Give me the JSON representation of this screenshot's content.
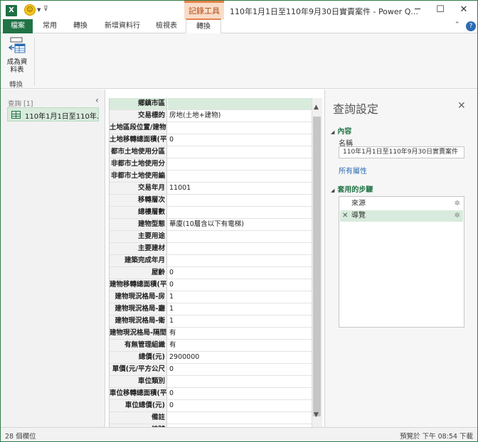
{
  "app": {
    "window_title": "110年1月1日至110年9月30日實賣案件 - Power Q...",
    "contextual_tools": "記錄工具",
    "window_controls": [
      "minimize-icon",
      "maximize-icon",
      "close-icon"
    ]
  },
  "ribbon": {
    "tabs": [
      {
        "label": "檔案",
        "kind": "file"
      },
      {
        "label": "常用"
      },
      {
        "label": "轉換"
      },
      {
        "label": "新增資料行"
      },
      {
        "label": "檢視表"
      },
      {
        "label": "轉換",
        "active": true
      }
    ],
    "convert_button_label": "成為資\n料表",
    "group_label": "轉換"
  },
  "queries": {
    "header": "查詢 [1]",
    "items": [
      {
        "label": "110年1月1日至110年..."
      }
    ]
  },
  "grid": {
    "rows": [
      {
        "field": "鄉鎮市區",
        "value": ""
      },
      {
        "field": "交易標的",
        "value": "房地(土地+建物)"
      },
      {
        "field": "土地區段位置/建物",
        "value": ""
      },
      {
        "field": "土地移轉總面積(平",
        "value": "0"
      },
      {
        "field": "都市土地使用分區",
        "value": ""
      },
      {
        "field": "非都市土地使用分",
        "value": ""
      },
      {
        "field": "非都市土地使用編",
        "value": ""
      },
      {
        "field": "交易年月",
        "value": "11001"
      },
      {
        "field": "移轉層次",
        "value": ""
      },
      {
        "field": "總樓層數",
        "value": ""
      },
      {
        "field": "建物型態",
        "value": "華廈(10層含以下有電梯)"
      },
      {
        "field": "主要用途",
        "value": ""
      },
      {
        "field": "主要建材",
        "value": ""
      },
      {
        "field": "建築完成年月",
        "value": ""
      },
      {
        "field": "屋齡",
        "value": "0"
      },
      {
        "field": "建物移轉總面積(平",
        "value": "0"
      },
      {
        "field": "建物現況格局-房",
        "value": "1"
      },
      {
        "field": "建物現況格局-廳",
        "value": "1"
      },
      {
        "field": "建物現況格局-衛",
        "value": "1"
      },
      {
        "field": "建物現況格局-隔間",
        "value": "有"
      },
      {
        "field": "有無管理組織",
        "value": "有"
      },
      {
        "field": "總價(元)",
        "value": "2900000"
      },
      {
        "field": "單價(元/平方公尺",
        "value": "0"
      },
      {
        "field": "車位類別",
        "value": ""
      },
      {
        "field": "車位移轉總面積(平",
        "value": "0"
      },
      {
        "field": "車位總價(元)",
        "value": "0"
      },
      {
        "field": "備註",
        "value": ""
      },
      {
        "field": "編號",
        "value": ""
      }
    ]
  },
  "settings": {
    "title": "查詢設定",
    "properties_section": "內容",
    "name_label": "名稱",
    "name_value": "110年1月1日至110年9月30日實賣案件",
    "all_properties_link": "所有屬性",
    "steps_section": "套用的步驟",
    "steps": [
      {
        "label": "來源",
        "active": false
      },
      {
        "label": "導覽",
        "active": true
      }
    ]
  },
  "status": {
    "columns": "28 個欄位",
    "preview": "預覽於 下午 08:54 下載"
  },
  "colors": {
    "brand": "#217346",
    "highlight": "#d8ebdc",
    "context_accent": "#e5844b"
  }
}
